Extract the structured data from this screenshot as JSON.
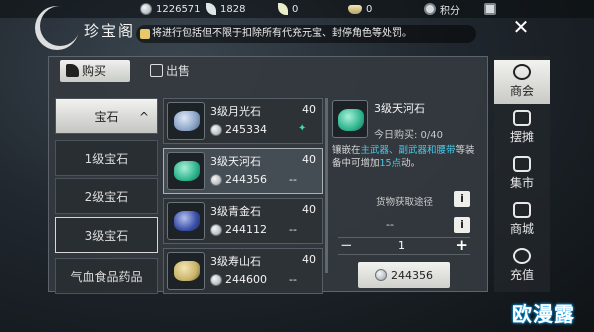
{
  "topbar": {
    "silver": "1226571",
    "leaf": "1828",
    "gold": "0",
    "ingot": "0",
    "score_label": "积分"
  },
  "title": "珍宝阁",
  "notice": "将进行包括但不限于扣除所有代充元宝、封停角色等处罚。",
  "tabs": {
    "buy": "购买",
    "sell": "出售"
  },
  "categories": [
    {
      "label": "宝石",
      "state": "expanded"
    },
    {
      "label": "1级宝石"
    },
    {
      "label": "2级宝石"
    },
    {
      "label": "3级宝石",
      "state": "selected"
    },
    {
      "label": "气血食品药品"
    }
  ],
  "items": [
    {
      "name": "3级月光石",
      "qty": "40",
      "price": "245334",
      "change": "",
      "color": "#8aa4c8"
    },
    {
      "name": "3级天河石",
      "qty": "40",
      "price": "244356",
      "change": "--",
      "color": "#2fb58f"
    },
    {
      "name": "3级青金石",
      "qty": "40",
      "price": "244112",
      "change": "--",
      "color": "#3a4fa8"
    },
    {
      "name": "3级寿山石",
      "qty": "40",
      "price": "244600",
      "change": "--",
      "color": "#c9b46a"
    }
  ],
  "detail": {
    "name": "3级天河石",
    "today": "今日购买: 0/40",
    "desc_a": "镶嵌在",
    "desc_b": "主武器、副武器和腰带",
    "desc_c": "等装备中可增加",
    "desc_d": "15点",
    "desc_e": "动。",
    "source_label": "货物获取途径",
    "dash": "--",
    "quantity": "1",
    "price": "244356"
  },
  "nav": [
    {
      "label": "商会"
    },
    {
      "label": "摆摊"
    },
    {
      "label": "集市"
    },
    {
      "label": "商城"
    },
    {
      "label": "充值"
    }
  ],
  "watermark": "欧漫露"
}
